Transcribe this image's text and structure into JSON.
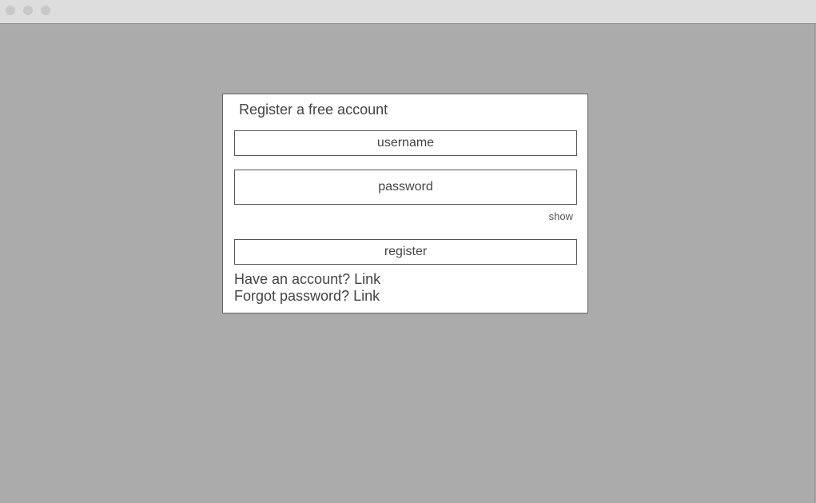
{
  "form": {
    "title": "Register a free account",
    "username_placeholder": "username",
    "password_placeholder": "password",
    "show_label": "show",
    "register_label": "register",
    "have_account_text": "Have an account? ",
    "have_account_link": "Link",
    "forgot_password_text": "Forgot password? ",
    "forgot_password_link": "Link"
  },
  "colors": {
    "background": "#ababab",
    "titlebar": "#dddddd",
    "card": "#ffffff",
    "border": "#555555",
    "text": "#444444"
  }
}
